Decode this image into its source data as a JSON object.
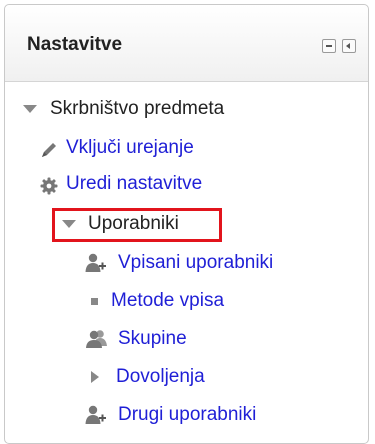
{
  "block": {
    "title": "Nastavitve",
    "controls": {
      "minimize_icon": "minus-square-icon",
      "dock_icon": "dock-left-icon"
    }
  },
  "tree": {
    "root_label": "Skrbništvo predmeta",
    "items": [
      {
        "label": "Vključi urejanje",
        "icon": "pencil-icon"
      },
      {
        "label": "Uredi nastavitve",
        "icon": "gear-icon"
      },
      {
        "label": "Uporabniki",
        "icon": "caret-down-icon"
      },
      {
        "label": "Vpisani uporabniki",
        "icon": "user-add-icon"
      },
      {
        "label": "Metode vpisa",
        "icon": "bullet-square-icon"
      },
      {
        "label": "Skupine",
        "icon": "users-group-icon"
      },
      {
        "label": "Dovoljenja",
        "icon": "caret-right-icon"
      },
      {
        "label": "Drugi uporabniki",
        "icon": "user-add-icon"
      }
    ]
  },
  "colors": {
    "link": "#1f1fd6",
    "highlight": "#e2141c"
  }
}
